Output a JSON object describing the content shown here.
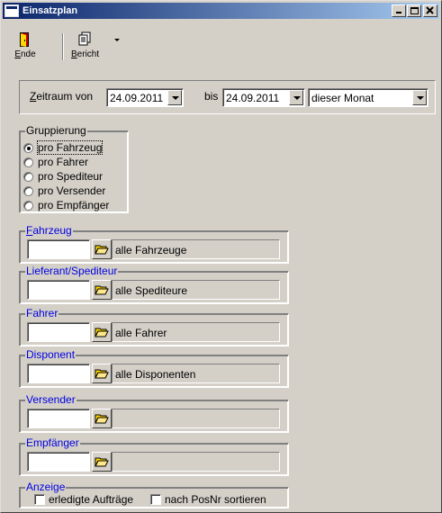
{
  "window": {
    "title": "Einsatzplan"
  },
  "toolbar": {
    "ende": {
      "label": "Ende",
      "mnemonic": "E",
      "rest": "nde"
    },
    "bericht": {
      "label": "Bericht",
      "mnemonic": "B",
      "rest": "ericht"
    }
  },
  "zeitraum": {
    "label_mnemonic": "Z",
    "label_rest": "eitraum von",
    "from_value": "24.09.2011",
    "bis_label": "bis",
    "to_value": "24.09.2011",
    "period_value": "dieser Monat"
  },
  "gruppierung": {
    "title": "Gruppierung",
    "options": [
      {
        "label": "pro Fahrzeug",
        "checked": true
      },
      {
        "label": "pro Fahrer",
        "checked": false
      },
      {
        "label": "pro Spediteur",
        "checked": false
      },
      {
        "label": "pro Versender",
        "checked": false
      },
      {
        "label": "pro Empfänger",
        "checked": false
      }
    ]
  },
  "filters": [
    {
      "title_mnemonic": "F",
      "title_rest": "ahrzeug",
      "code": "",
      "desc": "alle Fahrzeuge"
    },
    {
      "title_mnemonic": "",
      "title_rest": "Lieferant/Spediteur",
      "code": "",
      "desc": "alle Spediteure"
    },
    {
      "title_mnemonic": "",
      "title_rest": "Fahrer",
      "code": "",
      "desc": "alle Fahrer"
    },
    {
      "title_mnemonic": "",
      "title_rest": "Disponent",
      "code": "",
      "desc": "alle Disponenten"
    },
    {
      "title_mnemonic": "",
      "title_rest": "Versender",
      "code": "",
      "desc": ""
    },
    {
      "title_mnemonic": "",
      "title_rest": "Empfänger",
      "code": "",
      "desc": ""
    }
  ],
  "anzeige": {
    "title": "Anzeige",
    "erledigte": {
      "label": "erledigte Aufträge",
      "checked": false
    },
    "posnr": {
      "label": "nach PosNr sortieren",
      "checked": false
    }
  },
  "colors": {
    "title_start": "#0a246a",
    "title_end": "#a6caf0",
    "face": "#d4d0c8",
    "link_blue": "#0000e0"
  },
  "icons": {
    "ende": "door-exit-icon",
    "bericht": "report-pages-icon",
    "lookup": "folder-open-icon"
  }
}
